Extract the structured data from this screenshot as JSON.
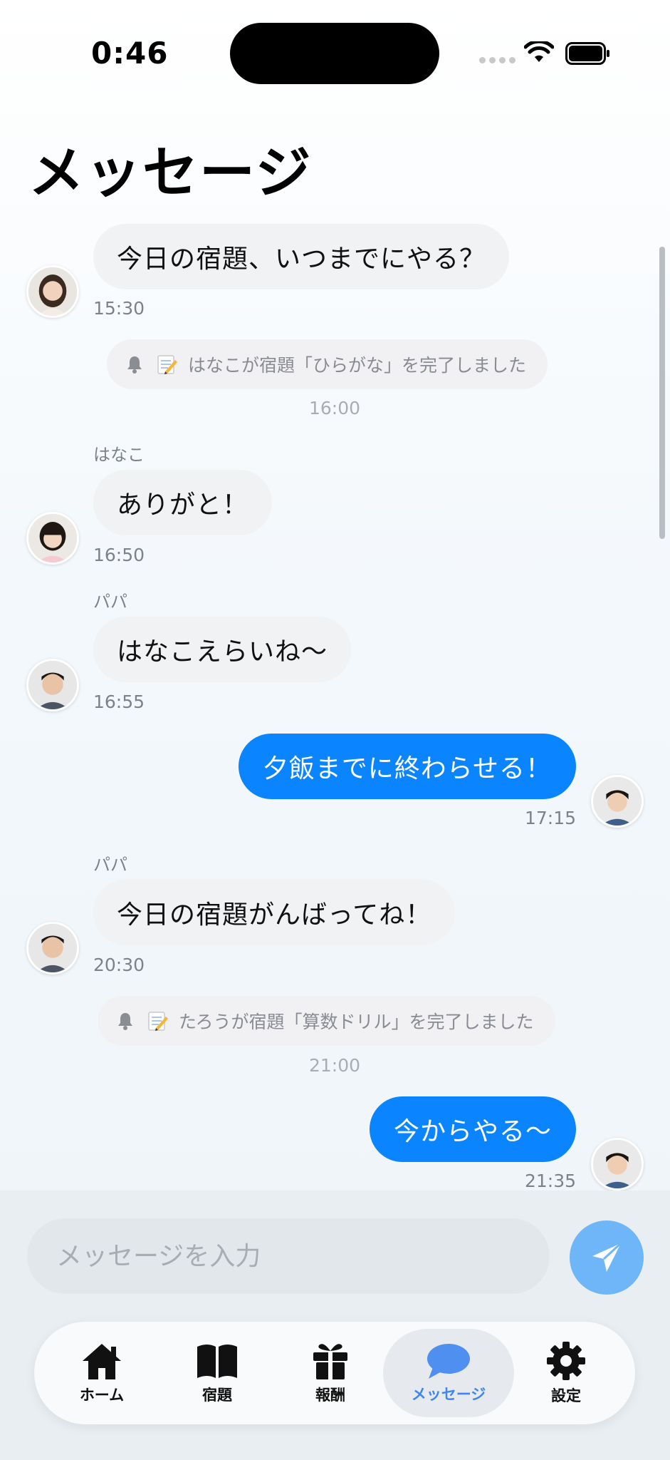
{
  "status_bar": {
    "time": "0:46"
  },
  "page_title": "メッセージ",
  "messages": [
    {
      "type": "incoming",
      "sender": "",
      "text": "今日の宿題、いつまでにやる？",
      "time": "15:30"
    },
    {
      "type": "system",
      "icon": "memo-icon",
      "text": "はなこが宿題「ひらがな」を完了しました",
      "time": "16:00"
    },
    {
      "type": "incoming",
      "sender": "はなこ",
      "text": "ありがと！",
      "time": "16:50"
    },
    {
      "type": "incoming",
      "sender": "パパ",
      "text": "はなこえらいね〜",
      "time": "16:55"
    },
    {
      "type": "outgoing",
      "text": "夕飯までに終わらせる！",
      "time": "17:15"
    },
    {
      "type": "incoming",
      "sender": "パパ",
      "text": "今日の宿題がんばってね！",
      "time": "20:30"
    },
    {
      "type": "system",
      "icon": "pencil-icon",
      "text": "たろうが宿題「算数ドリル」を完了しました",
      "time": "21:00"
    },
    {
      "type": "outgoing",
      "text": "今からやる〜",
      "time": "21:35"
    }
  ],
  "composer": {
    "placeholder": "メッセージを入力",
    "value": ""
  },
  "tabs": [
    {
      "label": "ホーム",
      "icon": "home-icon",
      "active": false
    },
    {
      "label": "宿題",
      "icon": "book-icon",
      "active": false
    },
    {
      "label": "報酬",
      "icon": "gift-icon",
      "active": false
    },
    {
      "label": "メッセージ",
      "icon": "chat-bubble-icon",
      "active": true
    },
    {
      "label": "設定",
      "icon": "gear-icon",
      "active": false
    }
  ],
  "colors": {
    "accent": "#0a84ff",
    "send_button": "#6fb6f9",
    "active_tab_text": "#3f86f0",
    "incoming_bubble": "#f1f2f4",
    "system_pill": "#f1f1f4"
  }
}
